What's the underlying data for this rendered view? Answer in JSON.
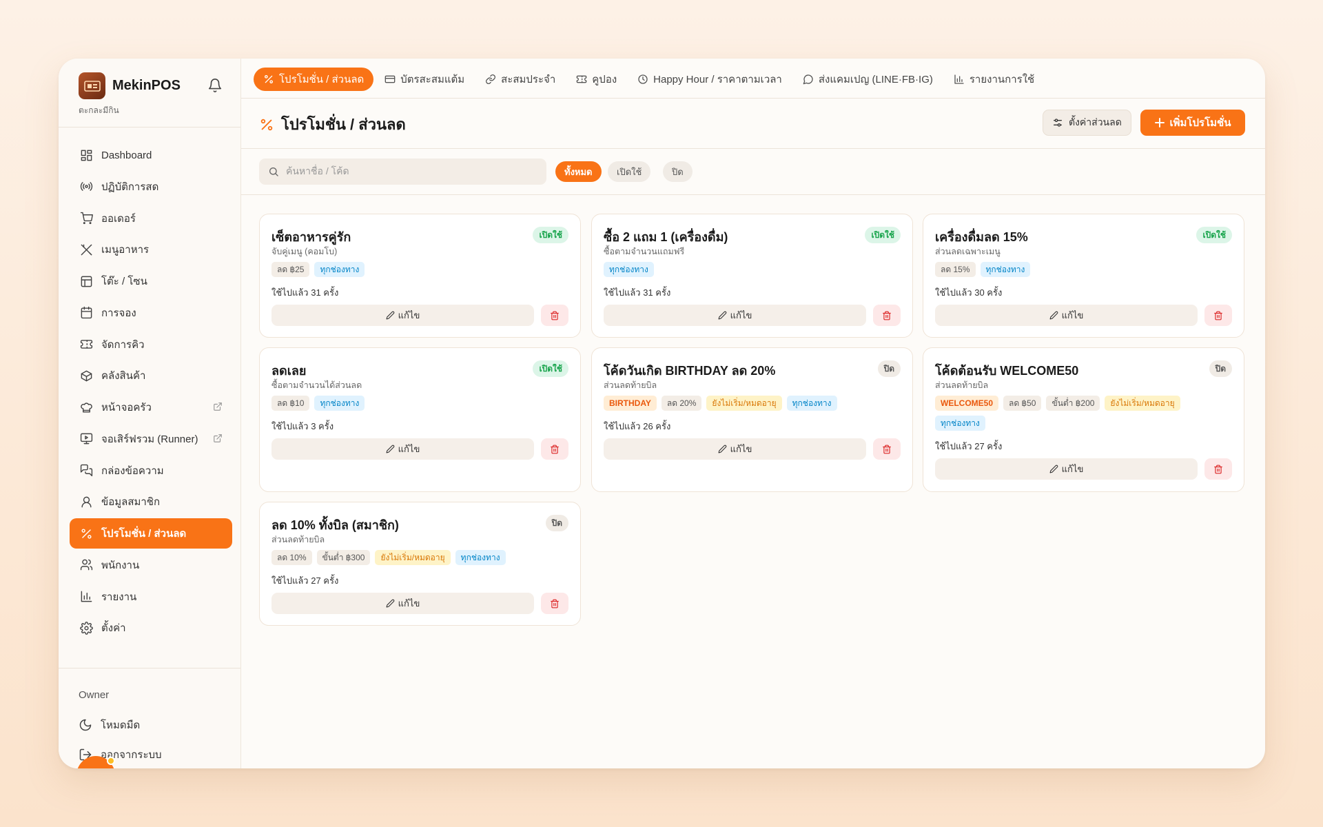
{
  "app": {
    "name": "MekinPOS",
    "subtitle": "ตะกละมีกิน",
    "logo_text": "mekin POS"
  },
  "sidebar": {
    "items": [
      {
        "label": "Dashboard",
        "icon": "dashboard-icon"
      },
      {
        "label": "ปฏิบัติการสด",
        "icon": "broadcast-icon"
      },
      {
        "label": "ออเดอร์",
        "icon": "cart-icon"
      },
      {
        "label": "เมนูอาหาร",
        "icon": "utensils-icon"
      },
      {
        "label": "โต๊ะ / โซน",
        "icon": "table-icon"
      },
      {
        "label": "การจอง",
        "icon": "calendar-icon"
      },
      {
        "label": "จัดการคิว",
        "icon": "ticket-icon"
      },
      {
        "label": "คลังสินค้า",
        "icon": "box-icon"
      },
      {
        "label": "หน้าจอครัว",
        "icon": "chef-hat-icon",
        "external": true
      },
      {
        "label": "จอเสิร์ฟรวม (Runner)",
        "icon": "monitor-play-icon",
        "external": true
      },
      {
        "label": "กล่องข้อความ",
        "icon": "messages-icon"
      },
      {
        "label": "ข้อมูลสมาชิก",
        "icon": "user-icon"
      },
      {
        "label": "โปรโมชั่น / ส่วนลด",
        "icon": "percent-icon",
        "active": true
      },
      {
        "label": "พนักงาน",
        "icon": "users-icon"
      },
      {
        "label": "รายงาน",
        "icon": "bar-chart-icon"
      },
      {
        "label": "ตั้งค่า",
        "icon": "gear-icon"
      }
    ],
    "role": "Owner",
    "dark_mode": "โหมดมืด",
    "logout": "ออกจากระบบ"
  },
  "tabs": [
    {
      "label": "โปรโมชั่น / ส่วนลด",
      "icon": "percent-icon",
      "active": true
    },
    {
      "label": "บัตรสะสมแต้ม",
      "icon": "card-icon"
    },
    {
      "label": "สะสมประจำ",
      "icon": "link-icon"
    },
    {
      "label": "คูปอง",
      "icon": "ticket-icon"
    },
    {
      "label": "Happy Hour / ราคาตามเวลา",
      "icon": "clock-icon"
    },
    {
      "label": "ส่งแคมเปญ (LINE·FB·IG)",
      "icon": "message-icon"
    },
    {
      "label": "รายงานการใช้",
      "icon": "bar-chart-icon"
    }
  ],
  "page": {
    "title": "โปรโมชั่น / ส่วนลด",
    "settings_button": "ตั้งค่าส่วนลด",
    "add_button": "เพิ่มโปรโมชั่น"
  },
  "search": {
    "placeholder": "ค้นหาชื่อ / โค้ด"
  },
  "filters": [
    {
      "label": "ทั้งหมด",
      "active": true
    },
    {
      "label": "เปิดใช้"
    },
    {
      "label": "ปิด"
    }
  ],
  "labels": {
    "edit": "แก้ไข"
  },
  "colors": {
    "accent": "#f97316",
    "active_status": "#16a34a",
    "danger": "#dc2626"
  },
  "promotions": [
    {
      "title": "เซ็ตอาหารคู่รัก",
      "subtitle": "จับคู่เมนู (คอมโบ)",
      "status": "เปิดใช้",
      "active": true,
      "tags": [
        {
          "text": "ลด ฿25",
          "kind": "gray"
        },
        {
          "text": "ทุกช่องทาง",
          "kind": "blue"
        }
      ],
      "usage": "ใช้ไปแล้ว 31 ครั้ง"
    },
    {
      "title": "ซื้อ 2 แถม 1 (เครื่องดื่ม)",
      "subtitle": "ซื้อตามจำนวนแถมฟรี",
      "status": "เปิดใช้",
      "active": true,
      "tags": [
        {
          "text": "ทุกช่องทาง",
          "kind": "blue"
        }
      ],
      "usage": "ใช้ไปแล้ว 31 ครั้ง"
    },
    {
      "title": "เครื่องดื่มลด 15%",
      "subtitle": "ส่วนลดเฉพาะเมนู",
      "status": "เปิดใช้",
      "active": true,
      "tags": [
        {
          "text": "ลด 15%",
          "kind": "gray"
        },
        {
          "text": "ทุกช่องทาง",
          "kind": "blue"
        }
      ],
      "usage": "ใช้ไปแล้ว 30 ครั้ง"
    },
    {
      "title": "ลดเลย",
      "subtitle": "ซื้อตามจำนวนได้ส่วนลด",
      "status": "เปิดใช้",
      "active": true,
      "tags": [
        {
          "text": "ลด ฿10",
          "kind": "gray"
        },
        {
          "text": "ทุกช่องทาง",
          "kind": "blue"
        }
      ],
      "usage": "ใช้ไปแล้ว 3 ครั้ง"
    },
    {
      "title": "โค้ดวันเกิด BIRTHDAY ลด 20%",
      "subtitle": "ส่วนลดท้ายบิล",
      "status": "ปิด",
      "active": false,
      "tags": [
        {
          "text": "BIRTHDAY",
          "kind": "orange"
        },
        {
          "text": "ลด 20%",
          "kind": "gray"
        },
        {
          "text": "ยังไม่เริ่ม/หมดอายุ",
          "kind": "yellow"
        },
        {
          "text": "ทุกช่องทาง",
          "kind": "blue"
        }
      ],
      "usage": "ใช้ไปแล้ว 26 ครั้ง"
    },
    {
      "title": "โค้ดต้อนรับ WELCOME50",
      "subtitle": "ส่วนลดท้ายบิล",
      "status": "ปิด",
      "active": false,
      "tags": [
        {
          "text": "WELCOME50",
          "kind": "orange"
        },
        {
          "text": "ลด ฿50",
          "kind": "gray"
        },
        {
          "text": "ขั้นต่ำ ฿200",
          "kind": "gray"
        },
        {
          "text": "ยังไม่เริ่ม/หมดอายุ",
          "kind": "yellow"
        },
        {
          "text": "ทุกช่องทาง",
          "kind": "blue"
        }
      ],
      "usage": "ใช้ไปแล้ว 27 ครั้ง"
    },
    {
      "title": "ลด 10% ทั้งบิล (สมาชิก)",
      "subtitle": "ส่วนลดท้ายบิล",
      "status": "ปิด",
      "active": false,
      "tags": [
        {
          "text": "ลด 10%",
          "kind": "gray"
        },
        {
          "text": "ขั้นต่ำ ฿300",
          "kind": "gray"
        },
        {
          "text": "ยังไม่เริ่ม/หมดอายุ",
          "kind": "yellow"
        },
        {
          "text": "ทุกช่องทาง",
          "kind": "blue"
        }
      ],
      "usage": "ใช้ไปแล้ว 27 ครั้ง"
    }
  ]
}
